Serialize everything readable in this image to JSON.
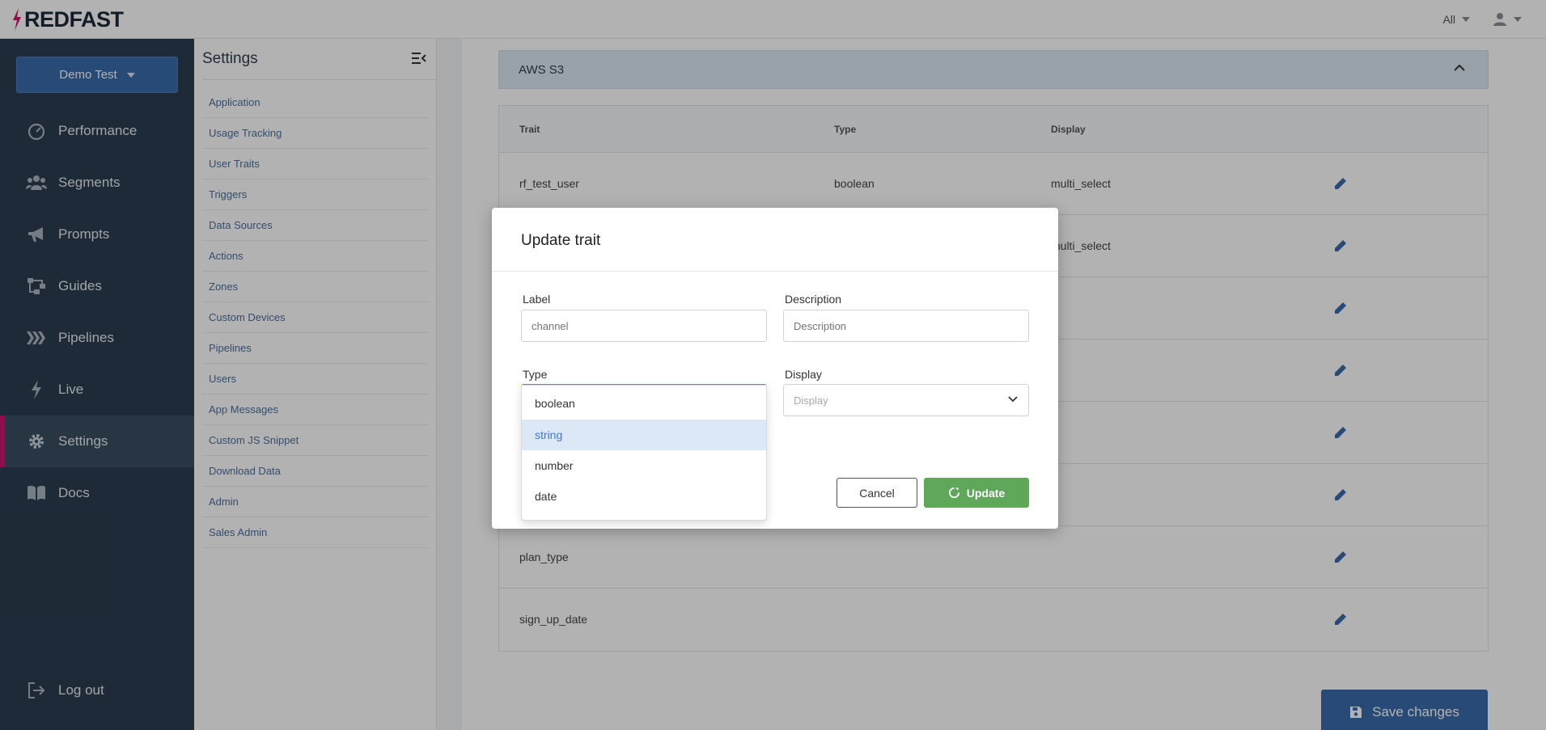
{
  "app": {
    "brand": "REDFAST"
  },
  "topbar": {
    "filter_label": "All"
  },
  "account": {
    "label": "Demo Test"
  },
  "nav": {
    "items": [
      {
        "label": "Performance",
        "icon": "gauge-icon"
      },
      {
        "label": "Segments",
        "icon": "users-icon"
      },
      {
        "label": "Prompts",
        "icon": "megaphone-icon"
      },
      {
        "label": "Guides",
        "icon": "flow-icon"
      },
      {
        "label": "Pipelines",
        "icon": "pipelines-icon"
      },
      {
        "label": "Live",
        "icon": "bolt-icon"
      },
      {
        "label": "Settings",
        "icon": "gear-icon",
        "active": true
      },
      {
        "label": "Docs",
        "icon": "book-icon"
      }
    ],
    "logout_label": "Log out"
  },
  "settings_menu": {
    "title": "Settings",
    "items": [
      "Application",
      "Usage Tracking",
      "User Traits",
      "Triggers",
      "Data Sources",
      "Actions",
      "Zones",
      "Custom Devices",
      "Pipelines",
      "Users",
      "App Messages",
      "Custom JS Snippet",
      "Download Data",
      "Admin",
      "Sales Admin"
    ]
  },
  "main": {
    "section_title": "AWS S3",
    "table": {
      "headers": [
        "Trait",
        "Type",
        "Display"
      ],
      "rows": [
        {
          "trait": "rf_test_user",
          "type": "boolean",
          "display": "multi_select"
        },
        {
          "trait": "",
          "type": "",
          "display": "multi_select"
        },
        {
          "trait": "",
          "type": "",
          "display": ""
        },
        {
          "trait": "",
          "type": "",
          "display": ""
        },
        {
          "trait": "",
          "type": "",
          "display": ""
        },
        {
          "trait": "",
          "type": "",
          "display": ""
        },
        {
          "trait": "plan_type",
          "type": "",
          "display": ""
        },
        {
          "trait": "sign_up_date",
          "type": "",
          "display": ""
        }
      ]
    },
    "save_label": "Save changes"
  },
  "modal": {
    "title": "Update trait",
    "label_field": {
      "label": "Label",
      "placeholder": "channel"
    },
    "description_field": {
      "label": "Description",
      "placeholder": "Description"
    },
    "type_field": {
      "label": "Type"
    },
    "display_field": {
      "label": "Display",
      "placeholder": "Display"
    },
    "cancel_label": "Cancel",
    "update_label": "Update"
  },
  "type_dropdown": {
    "options": [
      "boolean",
      "string",
      "number",
      "date"
    ],
    "selected": "string"
  },
  "colors": {
    "accent": "#3a6aa9",
    "nav_bg": "#2b3d4f",
    "active_marker": "#d0146a",
    "update_green": "#5fa85a"
  }
}
